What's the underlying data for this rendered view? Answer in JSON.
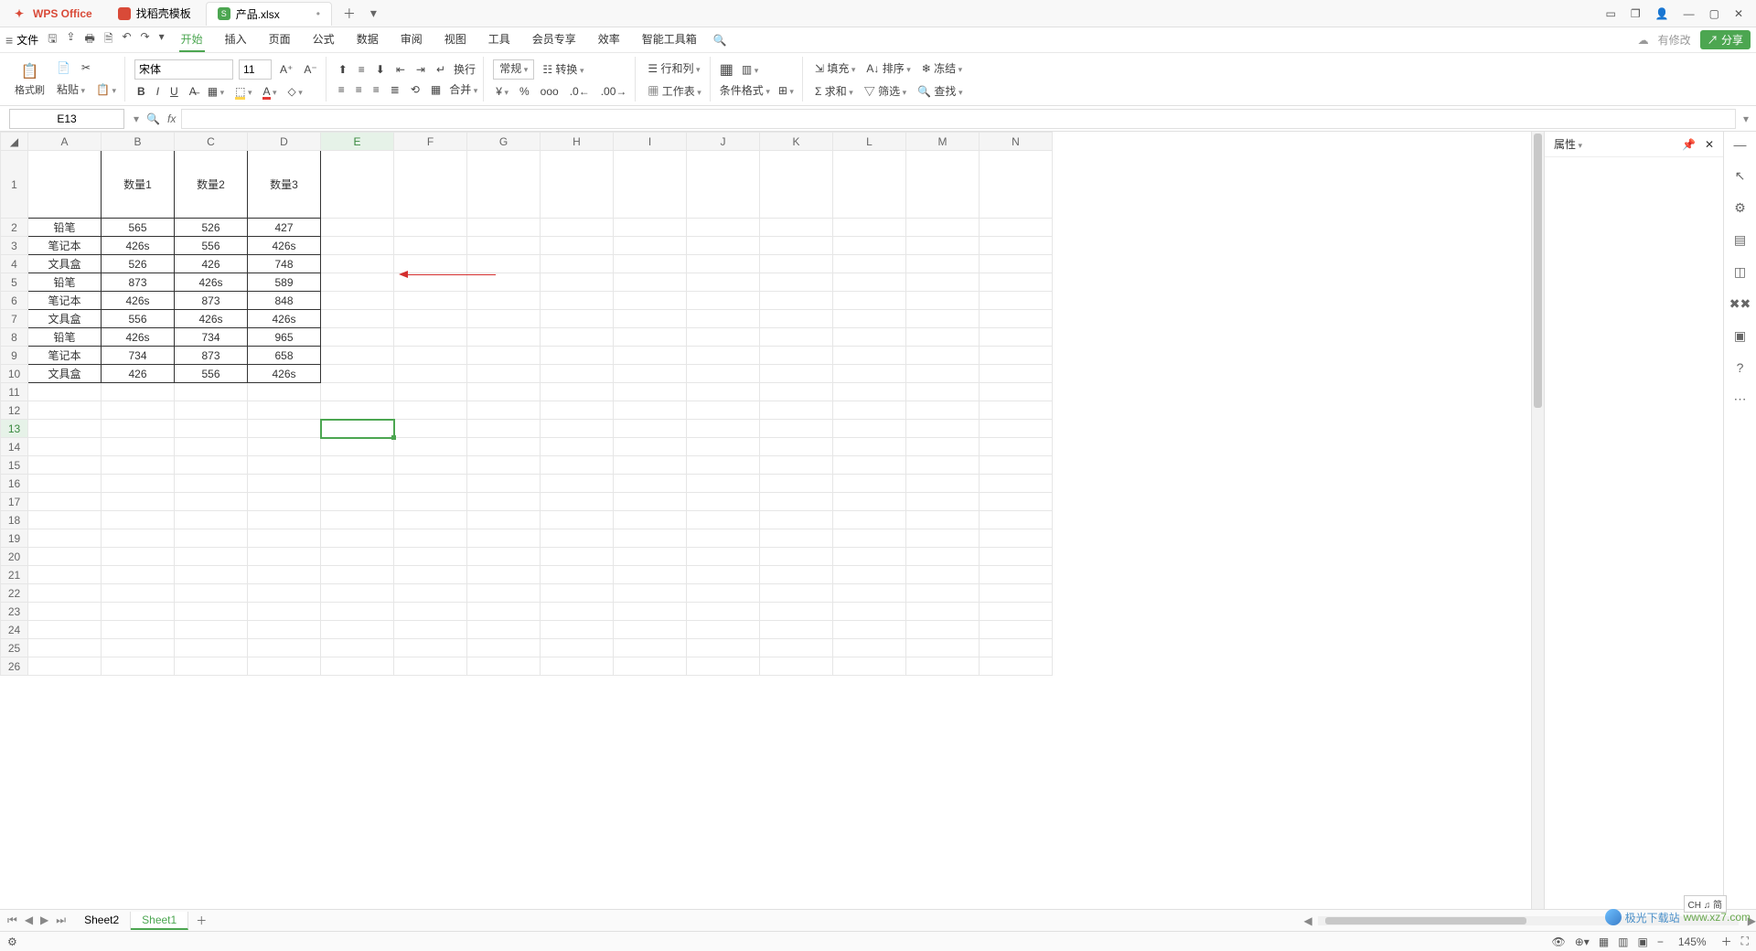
{
  "title": {
    "app": "WPS Office",
    "tab2": "找稻壳模板",
    "tab3": "产品.xlsx",
    "tab3_icon": "S"
  },
  "menubar": {
    "file": "文件",
    "tabs": [
      "开始",
      "插入",
      "页面",
      "公式",
      "数据",
      "审阅",
      "视图",
      "工具",
      "会员专享",
      "效率",
      "智能工具箱"
    ],
    "active": 0,
    "pending": "有修改",
    "share": "分享"
  },
  "ribbon": {
    "format_brush": "格式刷",
    "paste": "粘贴",
    "font": "宋体",
    "size": "11",
    "wrap": "换行",
    "merge": "合并",
    "general": "常规",
    "convert": "转换",
    "row_col": "行和列",
    "worksheet": "工作表",
    "condfmt": "条件格式",
    "fill": "填充",
    "sort": "排序",
    "freeze": "冻结",
    "sum": "求和",
    "filter": "筛选",
    "find": "查找"
  },
  "namebox": "E13",
  "grid": {
    "columns": [
      "A",
      "B",
      "C",
      "D",
      "E",
      "F",
      "G",
      "H",
      "I",
      "J",
      "K",
      "L",
      "M",
      "N"
    ],
    "header_row": [
      "",
      "数量1",
      "数量2",
      "数量3"
    ],
    "rows": [
      {
        "n": 2,
        "c": [
          "铅笔",
          "565",
          "526",
          "427"
        ],
        "red": []
      },
      {
        "n": 3,
        "c": [
          "笔记本",
          "426s",
          "556",
          "426s"
        ],
        "red": [
          1,
          3
        ]
      },
      {
        "n": 4,
        "c": [
          "文具盒",
          "526",
          "426",
          "748"
        ],
        "red": []
      },
      {
        "n": 5,
        "c": [
          "铅笔",
          "873",
          "426s",
          "589"
        ],
        "red": [
          2
        ]
      },
      {
        "n": 6,
        "c": [
          "笔记本",
          "426s",
          "873",
          "848"
        ],
        "red": [
          1
        ]
      },
      {
        "n": 7,
        "c": [
          "文具盒",
          "556",
          "426s",
          "426s"
        ],
        "red": [
          2,
          3
        ]
      },
      {
        "n": 8,
        "c": [
          "铅笔",
          "426s",
          "734",
          "965"
        ],
        "red": [
          1
        ]
      },
      {
        "n": 9,
        "c": [
          "笔记本",
          "734",
          "873",
          "658"
        ],
        "red": []
      },
      {
        "n": 10,
        "c": [
          "文具盒",
          "426",
          "556",
          "426s"
        ],
        "red": [
          3
        ]
      }
    ],
    "selected": {
      "row": 13,
      "col": "E"
    }
  },
  "rpanel": {
    "title": "属性"
  },
  "sheets": {
    "list": [
      "Sheet2",
      "Sheet1"
    ],
    "active": 1
  },
  "status": {
    "zoom": "145%",
    "ime": "CH ♫ 简"
  },
  "watermark": {
    "text": "极光下载站",
    "url": "www.xz7.com"
  }
}
